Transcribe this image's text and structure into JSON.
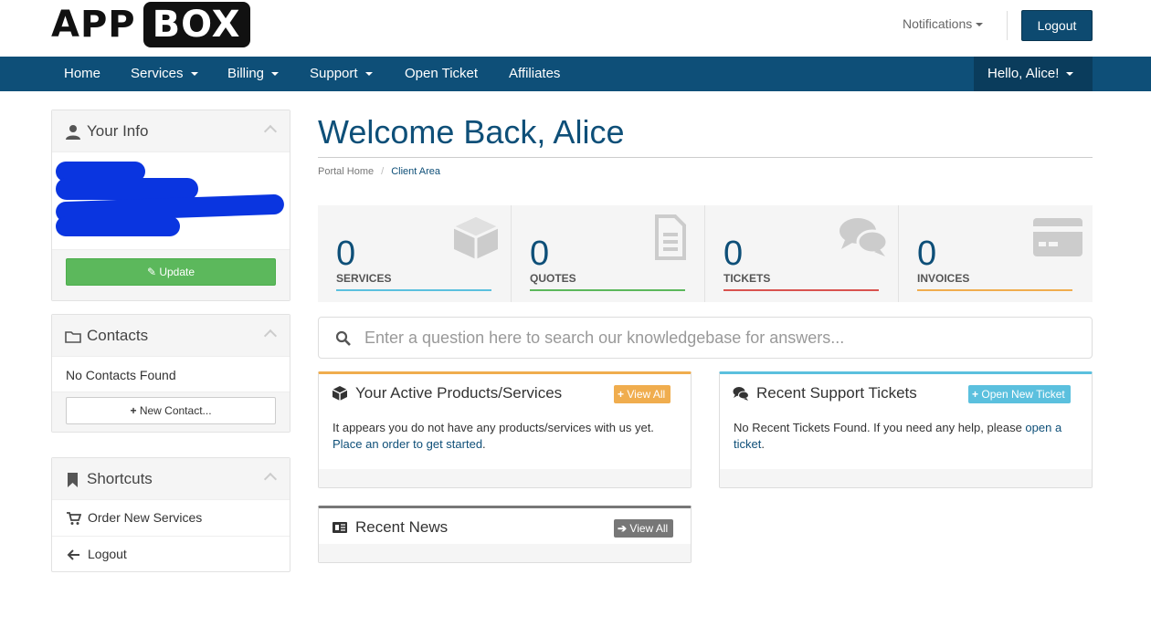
{
  "brand": {
    "app": "APP",
    "box": "BOX"
  },
  "header": {
    "notifications": "Notifications",
    "logout": "Logout"
  },
  "nav": {
    "home": "Home",
    "services": "Services",
    "billing": "Billing",
    "support": "Support",
    "open_ticket": "Open Ticket",
    "affiliates": "Affiliates",
    "hello": "Hello, Alice!"
  },
  "sidebar": {
    "your_info": {
      "title": "Your Info",
      "update_label": "Update"
    },
    "contacts": {
      "title": "Contacts",
      "empty": "No Contacts Found",
      "new_label": "New Contact..."
    },
    "shortcuts": {
      "title": "Shortcuts",
      "items": [
        {
          "label": "Order New Services",
          "icon": "cart-icon"
        },
        {
          "label": "Logout",
          "icon": "arrow-left-icon"
        }
      ]
    }
  },
  "main": {
    "title": "Welcome Back, Alice",
    "breadcrumb": {
      "home": "Portal Home",
      "current": "Client Area"
    },
    "stats": [
      {
        "value": "0",
        "label": "SERVICES",
        "color": "#5bc0de",
        "icon": "cube-icon"
      },
      {
        "value": "0",
        "label": "QUOTES",
        "color": "#5cb85c",
        "icon": "document-icon"
      },
      {
        "value": "0",
        "label": "TICKETS",
        "color": "#d9534f",
        "icon": "comments-icon"
      },
      {
        "value": "0",
        "label": "INVOICES",
        "color": "#f0ad4e",
        "icon": "credit-card-icon"
      }
    ],
    "kb_search": {
      "placeholder": "Enter a question here to search our knowledgebase for answers..."
    },
    "products": {
      "title": "Your Active Products/Services",
      "button": "View All",
      "text": "It appears you do not have any products/services with us yet.",
      "link": "Place an order to get started",
      "after_link": ".",
      "accent": "#f0ad4e"
    },
    "tickets": {
      "title": "Recent Support Tickets",
      "button": "Open New Ticket",
      "text": "No Recent Tickets Found. If you need any help, please ",
      "link": "open a ticket",
      "after_link": ".",
      "accent": "#5bc0de"
    },
    "news": {
      "title": "Recent News",
      "button": "View All",
      "accent": "#777777"
    }
  }
}
